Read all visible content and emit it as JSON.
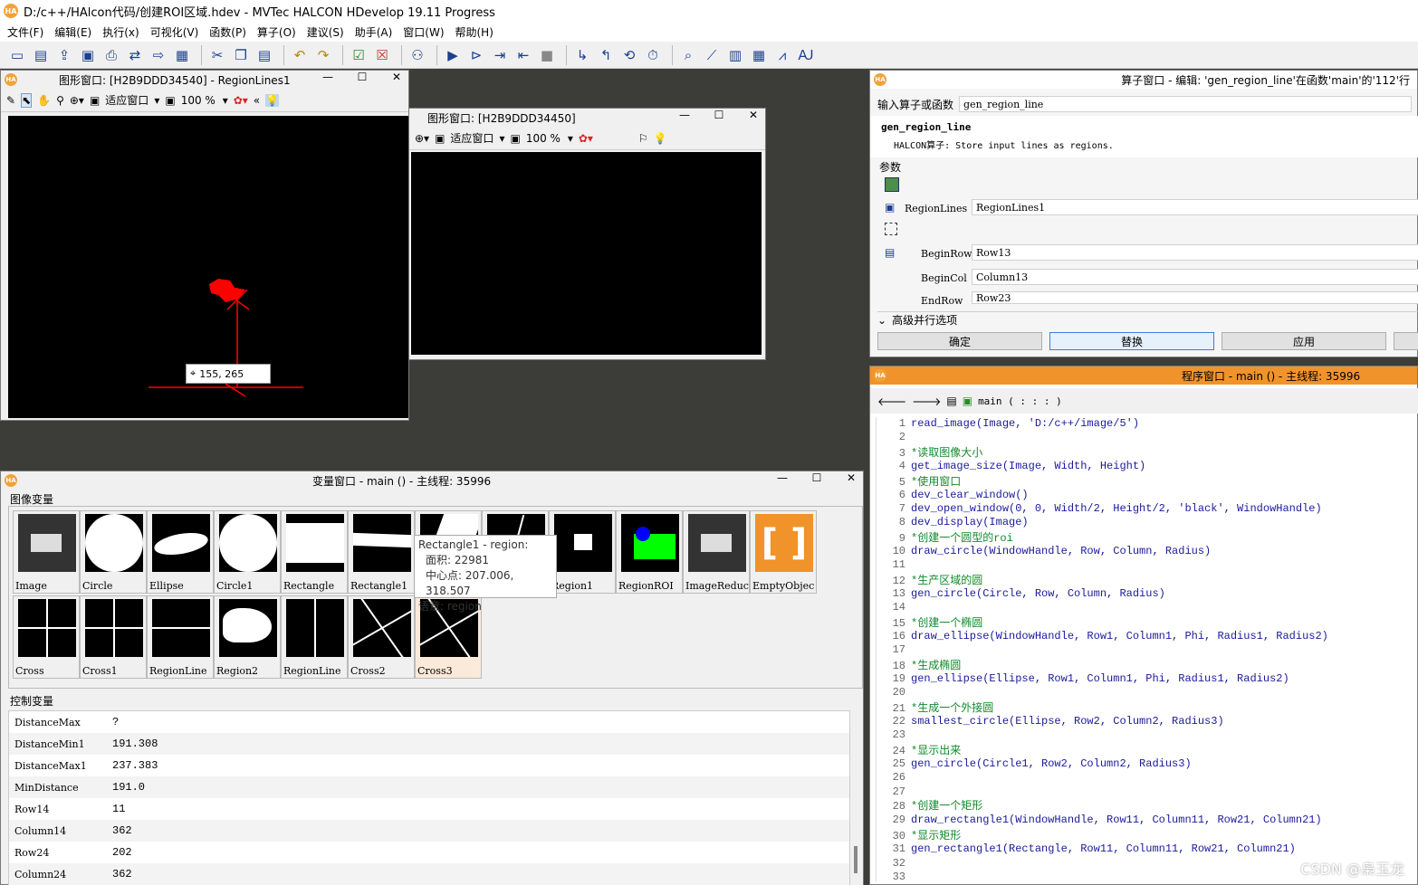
{
  "app": {
    "title": "D:/c++/HAlcon代码/创建ROI区域.hdev - MVTec HALCON HDevelop 19.11 Progress",
    "logo": "HA"
  },
  "menu": [
    "文件(F)",
    "编辑(E)",
    "执行(x)",
    "可视化(V)",
    "函数(P)",
    "算子(O)",
    "建议(S)",
    "助手(A)",
    "窗口(W)",
    "帮助(H)"
  ],
  "toolbar_icons": [
    "new-icon",
    "open-icon",
    "export-icon",
    "save-icon",
    "print-icon",
    "cut-icon",
    "copy-icon",
    "paste-icon",
    "undo-icon",
    "redo-icon",
    "run-icon",
    "stop-icon"
  ],
  "gwin1": {
    "title": "图形窗口: [H2B9DDD34540] - RegionLines1",
    "fit": "适应窗口",
    "zoom": "100 %",
    "coord": "155, 265"
  },
  "gwin2": {
    "title": "图形窗口: [H2B9DDD34450]",
    "fit": "适应窗口",
    "zoom": "100 %"
  },
  "opwin": {
    "title": "算子窗口 - 编辑: 'gen_region_line'在函数'main'的'112'行",
    "input_label": "输入算子或函数",
    "input_value": "gen_region_line",
    "op_name": "gen_region_line",
    "op_desc": "HALCON算子:  Store input lines as regions.",
    "params_label": "参数",
    "params": [
      {
        "name": "RegionLines",
        "value": "RegionLines1"
      },
      {
        "name": "BeginRow",
        "value": "Row13"
      },
      {
        "name": "BeginCol",
        "value": "Column13"
      },
      {
        "name": "EndRow",
        "value": "Row23"
      }
    ],
    "advanced": "高级并行选项",
    "ok": "确定",
    "replace": "替换",
    "apply": "应用"
  },
  "varwin": {
    "title": "变量窗口 - main () - 主线程: 35996",
    "iconic_label": "图像变量",
    "control_label": "控制变量",
    "thumbs": [
      "Image",
      "Circle",
      "Ellipse",
      "Circle1",
      "Rectangle",
      "Rectangle1",
      "",
      "",
      "Region1",
      "RegionROI",
      "ImageReduc",
      "EmptyObjec",
      "Cross",
      "Cross1",
      "RegionLine",
      "Region2",
      "RegionLine",
      "Cross2",
      "Cross3"
    ],
    "tooltip": {
      "l1": "Rectangle1 - region:",
      "l2": "面积: 22981",
      "l3": "中心点: 207.006, 318.507",
      "l4": "语意: region"
    },
    "controls": [
      {
        "n": "DistanceMax",
        "v": "?"
      },
      {
        "n": "DistanceMin1",
        "v": "191.308"
      },
      {
        "n": "DistanceMax1",
        "v": "237.383"
      },
      {
        "n": "MinDistance",
        "v": "191.0"
      },
      {
        "n": "Row14",
        "v": "11"
      },
      {
        "n": "Column14",
        "v": "362"
      },
      {
        "n": "Row24",
        "v": "202"
      },
      {
        "n": "Column24",
        "v": "362"
      }
    ]
  },
  "progwin": {
    "title": "程序窗口 - main () - 主线程: 35996",
    "proc": "main ( : : : )",
    "lines": [
      {
        "n": "1",
        "t": "read_image(Image, 'D:/c++/image/5')",
        "c": false
      },
      {
        "n": "2",
        "t": "",
        "c": false
      },
      {
        "n": "3",
        "t": "*读取图像大小",
        "c": true
      },
      {
        "n": "4",
        "t": "get_image_size(Image, Width, Height)",
        "c": false
      },
      {
        "n": "5",
        "t": "*使用窗口",
        "c": true
      },
      {
        "n": "6",
        "t": "dev_clear_window()",
        "c": false
      },
      {
        "n": "7",
        "t": "dev_open_window(0, 0, Width/2, Height/2, 'black', WindowHandle)",
        "c": false
      },
      {
        "n": "8",
        "t": "dev_display(Image)",
        "c": false
      },
      {
        "n": "9",
        "t": "*创建一个圆型的roi",
        "c": true
      },
      {
        "n": "10",
        "t": "draw_circle(WindowHandle, Row, Column, Radius)",
        "c": false
      },
      {
        "n": "11",
        "t": "",
        "c": false
      },
      {
        "n": "12",
        "t": "*生产区域的圆",
        "c": true
      },
      {
        "n": "13",
        "t": "gen_circle(Circle, Row, Column, Radius)",
        "c": false
      },
      {
        "n": "14",
        "t": "",
        "c": false
      },
      {
        "n": "15",
        "t": "*创建一个椭圆",
        "c": true
      },
      {
        "n": "16",
        "t": "draw_ellipse(WindowHandle, Row1, Column1, Phi, Radius1, Radius2)",
        "c": false
      },
      {
        "n": "17",
        "t": "",
        "c": false
      },
      {
        "n": "18",
        "t": "*生成椭圆",
        "c": true
      },
      {
        "n": "19",
        "t": "gen_ellipse(Ellipse, Row1, Column1, Phi, Radius1, Radius2)",
        "c": false
      },
      {
        "n": "20",
        "t": "",
        "c": false
      },
      {
        "n": "21",
        "t": "*生成一个外接圆",
        "c": true
      },
      {
        "n": "22",
        "t": "smallest_circle(Ellipse, Row2, Column2, Radius3)",
        "c": false
      },
      {
        "n": "23",
        "t": "",
        "c": false
      },
      {
        "n": "24",
        "t": "*显示出来",
        "c": true
      },
      {
        "n": "25",
        "t": "gen_circle(Circle1, Row2, Column2, Radius3)",
        "c": false
      },
      {
        "n": "26",
        "t": "",
        "c": false
      },
      {
        "n": "27",
        "t": "",
        "c": false
      },
      {
        "n": "28",
        "t": "*创建一个矩形",
        "c": true
      },
      {
        "n": "29",
        "t": "draw_rectangle1(WindowHandle, Row11, Column11, Row21, Column21)",
        "c": false
      },
      {
        "n": "30",
        "t": "*显示矩形",
        "c": true
      },
      {
        "n": "31",
        "t": "gen_rectangle1(Rectangle, Row11, Column11, Row21, Column21)",
        "c": false
      },
      {
        "n": "32",
        "t": "",
        "c": false
      },
      {
        "n": "33",
        "t": "",
        "c": false
      }
    ]
  },
  "watermark": "CSDN @枭玉龙"
}
